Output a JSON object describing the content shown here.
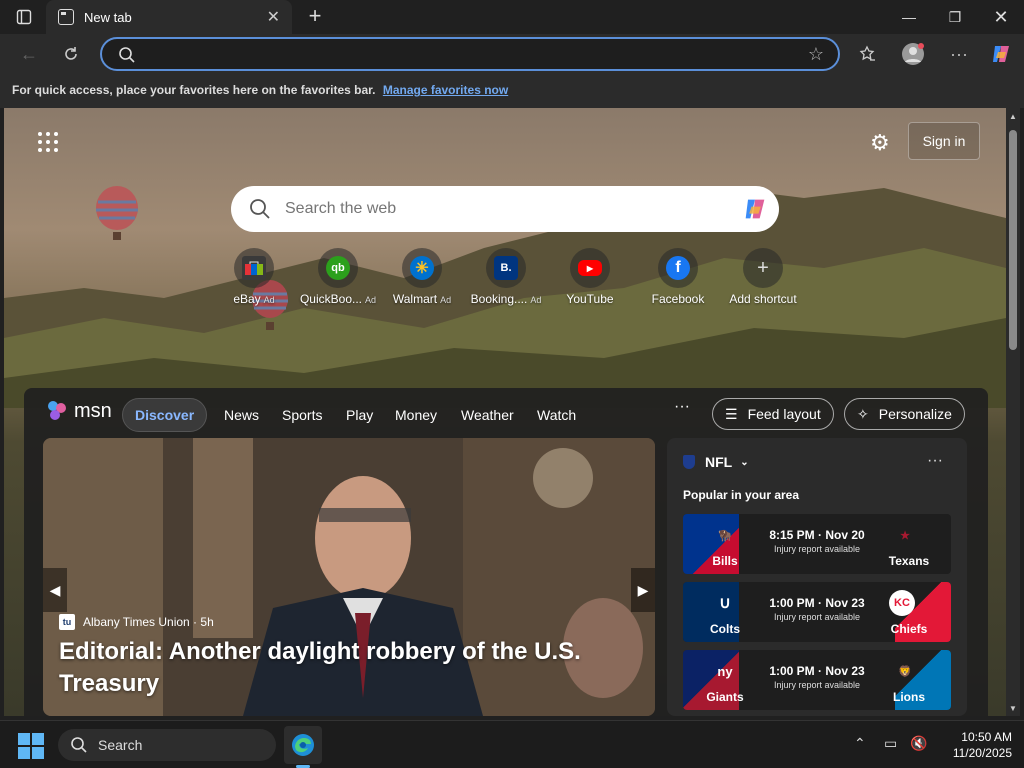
{
  "browser": {
    "tab_title": "New tab",
    "address_value": "",
    "favorites_message": "For quick access, place your favorites here on the favorites bar.",
    "favorites_link": "Manage favorites now"
  },
  "newtab": {
    "sign_in": "Sign in",
    "search_placeholder": "Search the web",
    "shortcuts": [
      {
        "label": "eBay",
        "ad": "Ad",
        "icon": "ebay-icon",
        "color": "#3a3a3a"
      },
      {
        "label": "QuickBoo...",
        "ad": "Ad",
        "icon": "quickbooks-icon",
        "color": "#2ca01c"
      },
      {
        "label": "Walmart",
        "ad": "Ad",
        "icon": "walmart-icon",
        "color": "#0071ce"
      },
      {
        "label": "Booking....",
        "ad": "Ad",
        "icon": "booking-icon",
        "color": "#003580"
      },
      {
        "label": "YouTube",
        "ad": "",
        "icon": "youtube-icon",
        "color": "#ff0000"
      },
      {
        "label": "Facebook",
        "ad": "",
        "icon": "facebook-icon",
        "color": "#1877f2"
      },
      {
        "label": "Add shortcut",
        "ad": "",
        "icon": "plus-icon",
        "color": "#555555"
      }
    ]
  },
  "msn": {
    "logo_text": "msn",
    "nav": [
      "Discover",
      "News",
      "Sports",
      "Play",
      "Money",
      "Weather",
      "Watch"
    ],
    "more": "···",
    "feed_layout": "Feed layout",
    "personalize": "Personalize"
  },
  "article": {
    "source": "Albany Times Union",
    "age": "5h",
    "source_abbr": "tu",
    "title": "Editorial: Another daylight robbery of the U.S. Treasury"
  },
  "nfl": {
    "title": "NFL",
    "subtitle": "Popular in your area",
    "games": [
      {
        "home": "Bills",
        "away": "Texans",
        "time": "8:15 PM · Nov 20",
        "note": "Injury report available",
        "home_color": "#00338d",
        "away_color": "#03202f"
      },
      {
        "home": "Colts",
        "away": "Chiefs",
        "time": "1:00 PM · Nov 23",
        "note": "Injury report available",
        "home_color": "#002c5f",
        "away_color": "#e31837"
      },
      {
        "home": "Giants",
        "away": "Lions",
        "time": "1:00 PM · Nov 23",
        "note": "Injury report available",
        "home_color": "#a71930",
        "away_color": "#0076b6"
      }
    ]
  },
  "taskbar": {
    "search": "Search",
    "time": "10:50 AM",
    "date": "11/20/2025"
  }
}
